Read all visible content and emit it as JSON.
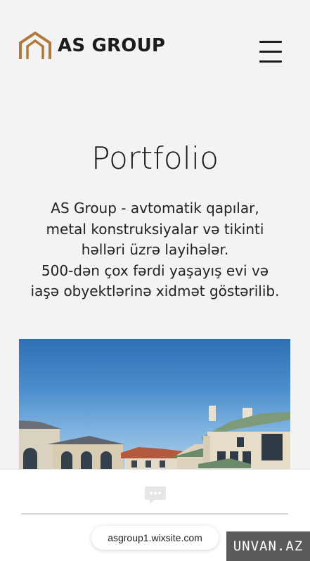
{
  "header": {
    "logo_text": "AS GROUP",
    "brand_color": "#b07a3c",
    "menu_icon": "hamburger-menu-icon"
  },
  "hero": {
    "title": "Portfolio",
    "description_lines": [
      "AS Group - avtomatik qapılar,",
      "metal konstruksiyalar və tikinti",
      "həlləri üzrə layihələr.",
      "500-dən çox fərdi yaşayış evi və",
      "iaşə obyektlərinə xidmət göstərilib."
    ]
  },
  "gallery": {
    "image": "houses-photo"
  },
  "bottom_bar": {
    "chat_icon": "chat-bubble-icon",
    "url": "asgroup1.wixsite.com"
  },
  "watermark": {
    "text": "UNVAN.AZ"
  }
}
